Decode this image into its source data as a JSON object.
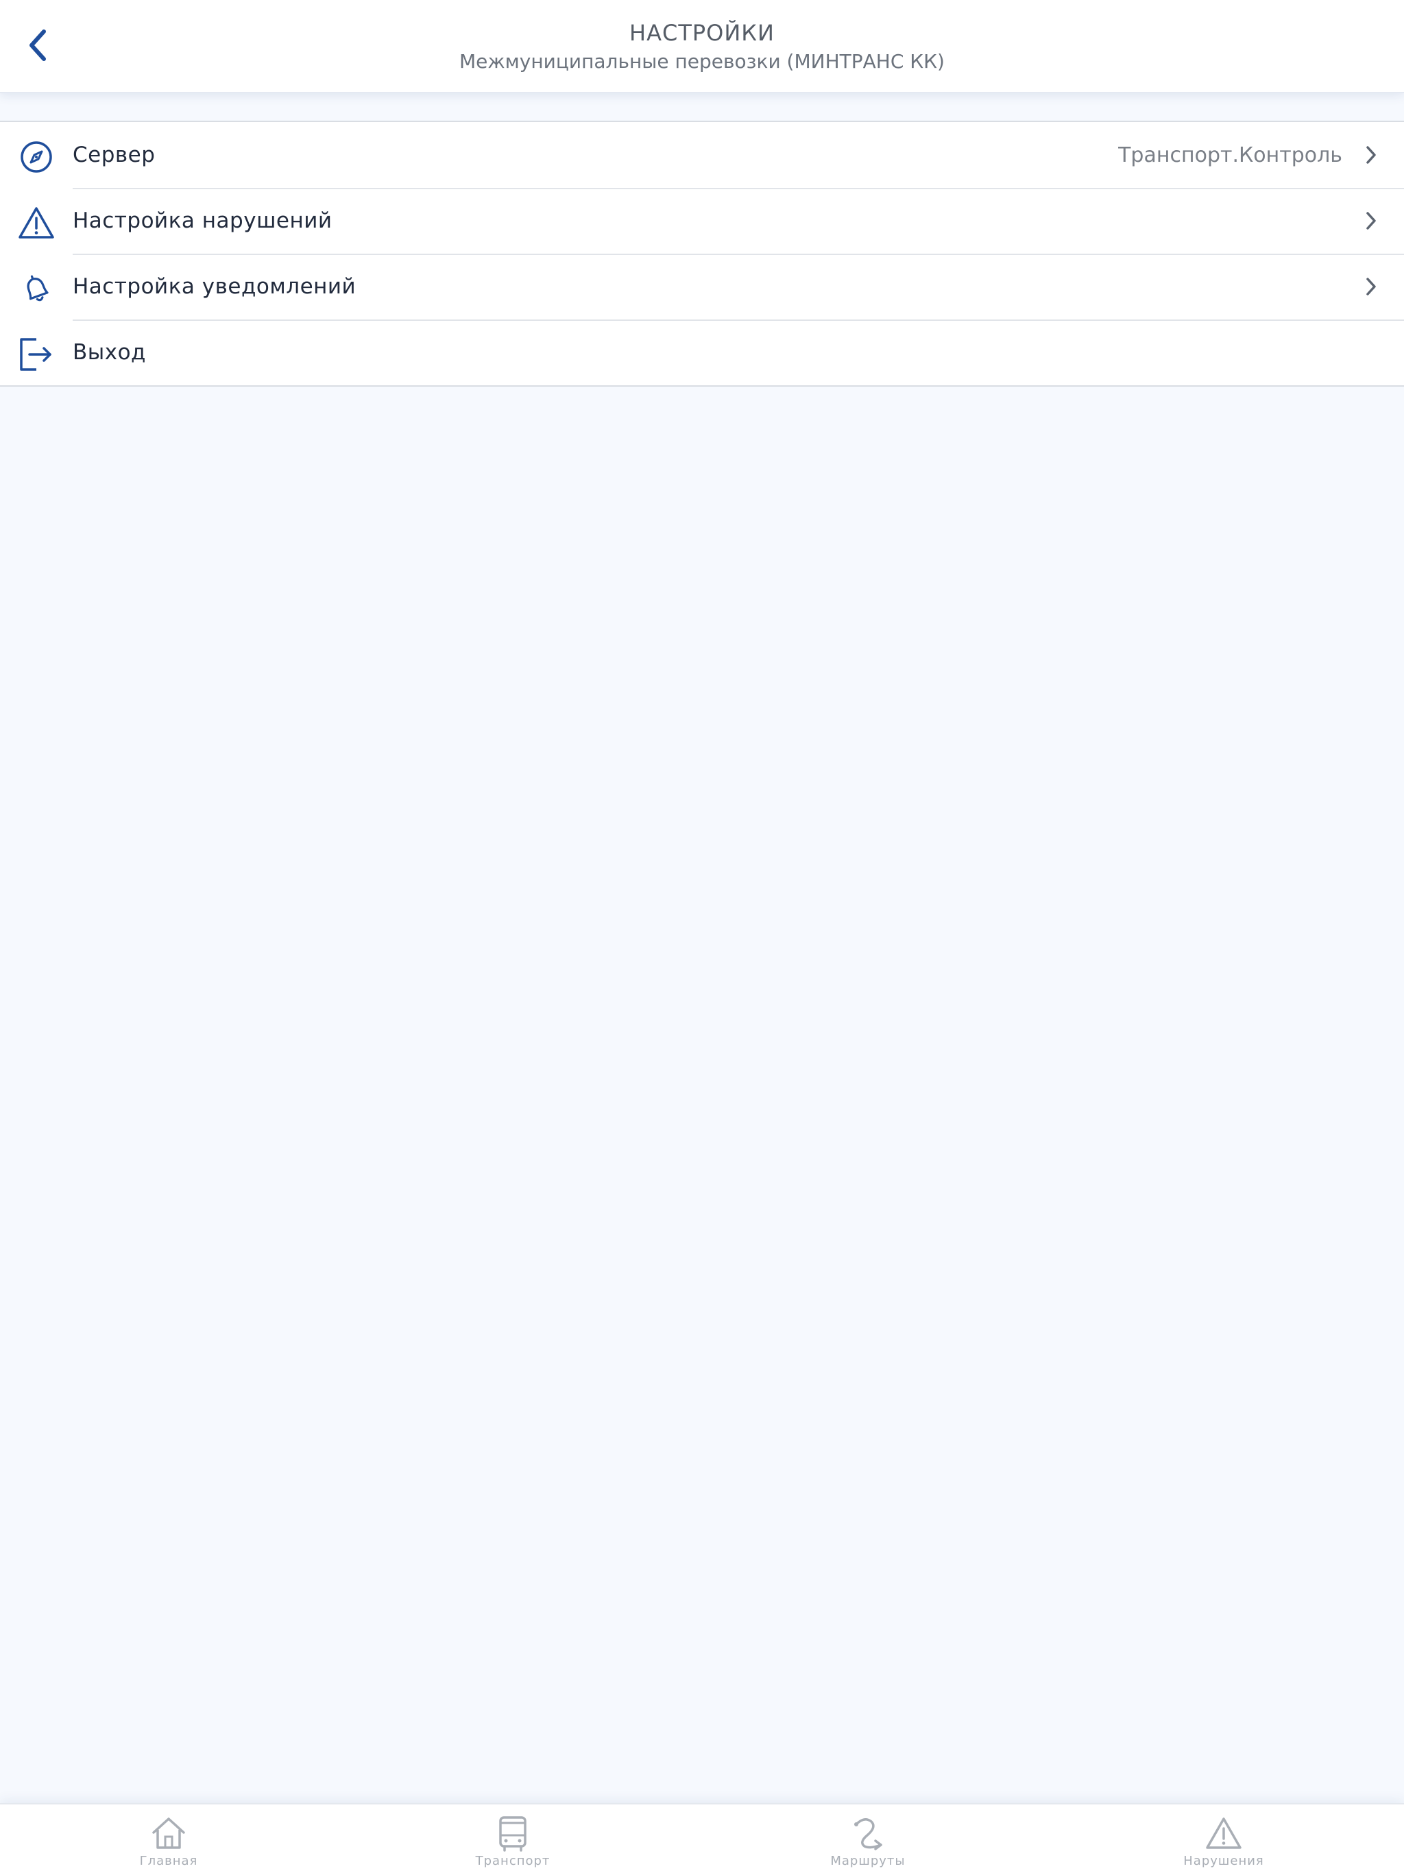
{
  "header": {
    "title": "НАСТРОЙКИ",
    "subtitle": "Межмуниципальные перевозки (МИНТРАНС КК)"
  },
  "settings": {
    "items": [
      {
        "icon": "compass-icon",
        "label": "Сервер",
        "value": "Транспорт.Контроль",
        "has_chevron": true
      },
      {
        "icon": "warning-triangle-icon",
        "label": "Настройка нарушений",
        "value": "",
        "has_chevron": true
      },
      {
        "icon": "bell-icon",
        "label": "Настройка уведомлений",
        "value": "",
        "has_chevron": true
      },
      {
        "icon": "logout-icon",
        "label": "Выход",
        "value": "",
        "has_chevron": false
      }
    ]
  },
  "tabbar": {
    "tabs": [
      {
        "icon": "home-icon",
        "label": "Главная"
      },
      {
        "icon": "bus-icon",
        "label": "Транспорт"
      },
      {
        "icon": "route-icon",
        "label": "Маршруты"
      },
      {
        "icon": "warning-triangle-icon",
        "label": "Нарушения"
      }
    ]
  },
  "colors": {
    "accent": "#1f4e9c",
    "background": "#f6f9fe",
    "tab_inactive": "#a9aeb5",
    "text_primary": "#222b3d",
    "text_secondary": "#7a7f87"
  }
}
